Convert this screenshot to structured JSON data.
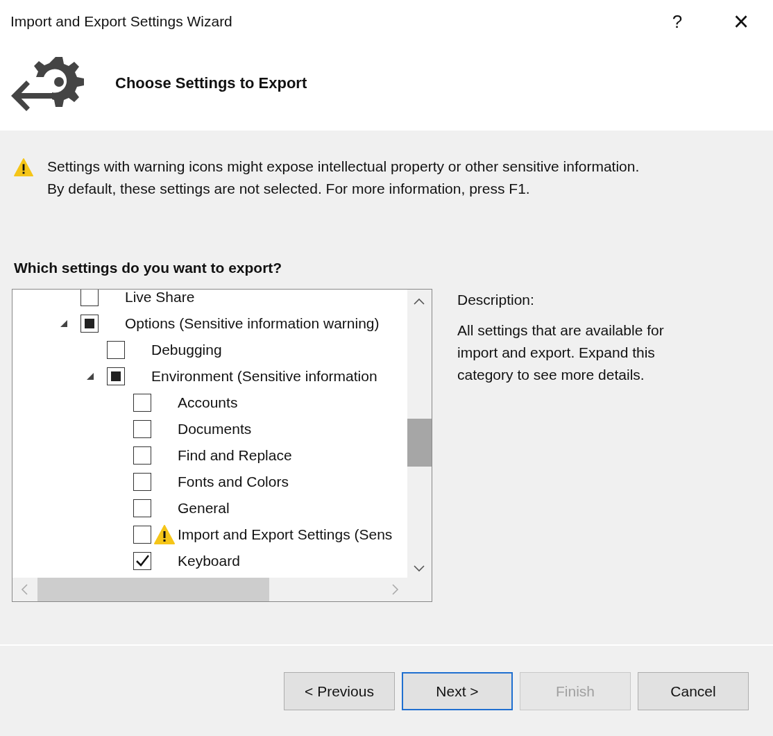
{
  "window": {
    "title": "Import and Export Settings Wizard",
    "help": "?",
    "close": "×"
  },
  "header": {
    "title": "Choose Settings to Export"
  },
  "warning": {
    "lines": [
      "Settings with warning icons might expose intellectual property or other sensitive information.",
      "By default, these settings are not selected. For more information, press F1."
    ]
  },
  "question": "Which settings do you want to export?",
  "tree": [
    {
      "label": "Live Share",
      "checked": false,
      "indeterminate": false,
      "warning": false
    },
    {
      "label": "Options (Sensitive information warning)",
      "checked": false,
      "indeterminate": true,
      "warning": false,
      "expanded": true,
      "children": [
        {
          "label": "Debugging",
          "checked": false,
          "indeterminate": false,
          "warning": false
        },
        {
          "label": "Environment (Sensitive information",
          "checked": false,
          "indeterminate": true,
          "warning": false,
          "expanded": true,
          "children": [
            {
              "label": "Accounts",
              "checked": false,
              "indeterminate": false,
              "warning": false
            },
            {
              "label": "Documents",
              "checked": false,
              "indeterminate": false,
              "warning": false
            },
            {
              "label": "Find and Replace",
              "checked": false,
              "indeterminate": false,
              "warning": false
            },
            {
              "label": "Fonts and Colors",
              "checked": false,
              "indeterminate": false,
              "warning": false
            },
            {
              "label": "General",
              "checked": false,
              "indeterminate": false,
              "warning": false
            },
            {
              "label": "Import and Export Settings (Sens",
              "checked": false,
              "indeterminate": false,
              "warning": true
            },
            {
              "label": "Keyboard",
              "checked": true,
              "indeterminate": false,
              "warning": false
            }
          ]
        }
      ]
    }
  ],
  "description": {
    "label": "Description:",
    "text": "All settings that are available for import and export. Expand this category to see more details."
  },
  "buttons": [
    {
      "label": "< Previous",
      "disabled": false,
      "focused": false
    },
    {
      "label": "Next >",
      "disabled": false,
      "focused": true
    },
    {
      "label": "Finish",
      "disabled": true,
      "focused": false
    },
    {
      "label": "Cancel",
      "disabled": false,
      "focused": false
    }
  ]
}
